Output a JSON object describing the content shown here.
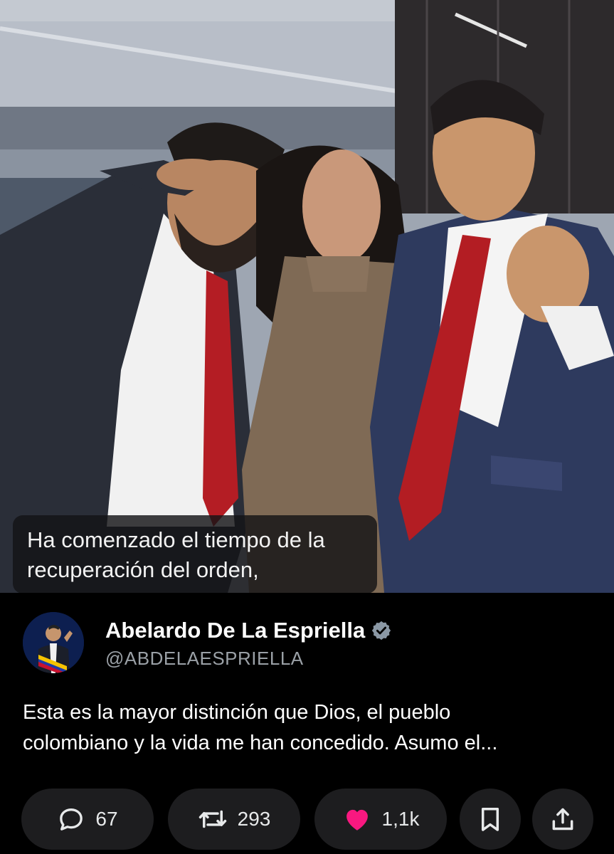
{
  "video": {
    "caption_lines": [
      "Ha comenzado el tiempo de la",
      "recuperación del orden,"
    ]
  },
  "author": {
    "display_name": "Abelardo De La Espriella",
    "handle": "@ABDELAESPRIELLA",
    "verified_icon": "verified-badge-icon",
    "avatar_icon": "avatar-image"
  },
  "tweet": {
    "text_lines": [
      "Esta es la mayor distinción que Dios, el pueblo",
      "colombiano y la vida me han concedido. Asumo el..."
    ]
  },
  "actions": {
    "reply": {
      "icon": "reply-icon",
      "count": "67"
    },
    "repost": {
      "icon": "repost-icon",
      "count": "293"
    },
    "like": {
      "icon": "heart-icon",
      "count": "1,1k",
      "liked": true
    },
    "bookmark": {
      "icon": "bookmark-icon"
    },
    "share": {
      "icon": "share-icon"
    }
  },
  "colors": {
    "background": "#000000",
    "pill": "#1d1d1f",
    "like_active": "#f91880",
    "verified_badge": "#8b98a5",
    "handle": "#9aa0a6"
  }
}
